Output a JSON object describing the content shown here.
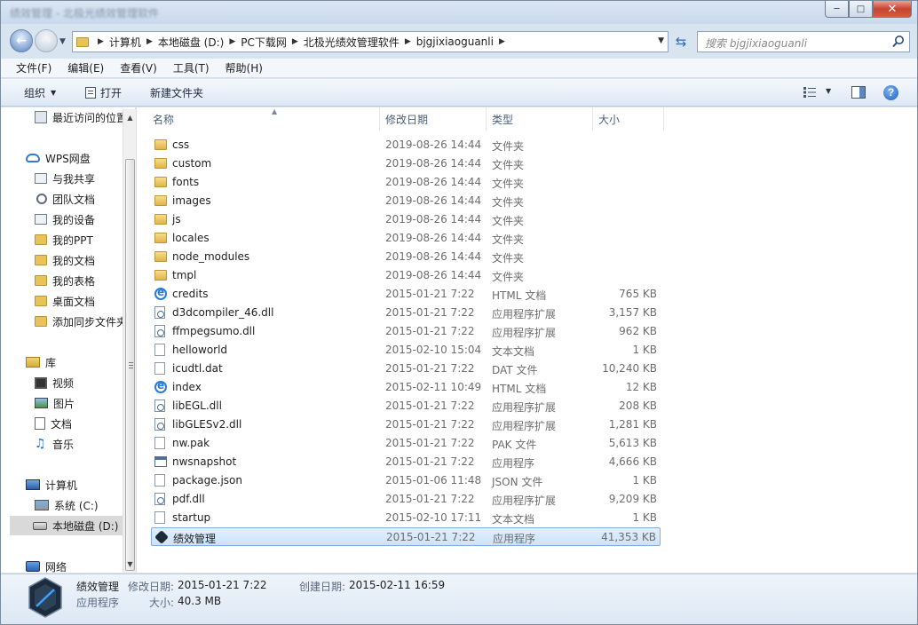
{
  "window": {
    "title": "绩效管理 - 北极光绩效管理软件",
    "minimize": "─",
    "maximize": "□",
    "close": "✕"
  },
  "address": {
    "crumbs": [
      "计算机",
      "本地磁盘 (D:)",
      "PC下载网",
      "北极光绩效管理软件",
      "bjgjixiaoguanli"
    ],
    "search_placeholder": "搜索 bjgjixiaoguanli"
  },
  "menu": [
    "文件(F)",
    "编辑(E)",
    "查看(V)",
    "工具(T)",
    "帮助(H)"
  ],
  "commands": {
    "organize": "组织",
    "open": "打开",
    "new_folder": "新建文件夹"
  },
  "nav": [
    {
      "label": "最近访问的位置",
      "icon": "recent-places-icon"
    },
    {
      "label": "WPS网盘",
      "icon": "cloud-icon"
    },
    {
      "label": "与我共享",
      "icon": "share-icon"
    },
    {
      "label": "团队文档",
      "icon": "team-icon"
    },
    {
      "label": "我的设备",
      "icon": "device-icon"
    },
    {
      "label": "我的PPT",
      "icon": "folder-icon"
    },
    {
      "label": "我的文档",
      "icon": "folder-icon"
    },
    {
      "label": "我的表格",
      "icon": "folder-icon"
    },
    {
      "label": "桌面文档",
      "icon": "folder-icon"
    },
    {
      "label": "添加同步文件夹",
      "icon": "folder-icon"
    },
    {
      "label": "库",
      "icon": "library-icon"
    },
    {
      "label": "视频",
      "icon": "video-icon"
    },
    {
      "label": "图片",
      "icon": "picture-icon"
    },
    {
      "label": "文档",
      "icon": "document-icon"
    },
    {
      "label": "音乐",
      "icon": "music-icon"
    },
    {
      "label": "计算机",
      "icon": "computer-icon"
    },
    {
      "label": "系统 (C:)",
      "icon": "system-drive-icon"
    },
    {
      "label": "本地磁盘 (D:)",
      "icon": "drive-icon"
    },
    {
      "label": "网络",
      "icon": "network-icon"
    }
  ],
  "columns": {
    "name": "名称",
    "date": "修改日期",
    "type": "类型",
    "size": "大小"
  },
  "files": [
    {
      "name": "css",
      "date": "2019-08-26 14:44",
      "type": "文件夹",
      "size": "",
      "icon": "folder"
    },
    {
      "name": "custom",
      "date": "2019-08-26 14:44",
      "type": "文件夹",
      "size": "",
      "icon": "folder"
    },
    {
      "name": "fonts",
      "date": "2019-08-26 14:44",
      "type": "文件夹",
      "size": "",
      "icon": "folder"
    },
    {
      "name": "images",
      "date": "2019-08-26 14:44",
      "type": "文件夹",
      "size": "",
      "icon": "folder"
    },
    {
      "name": "js",
      "date": "2019-08-26 14:44",
      "type": "文件夹",
      "size": "",
      "icon": "folder"
    },
    {
      "name": "locales",
      "date": "2019-08-26 14:44",
      "type": "文件夹",
      "size": "",
      "icon": "folder"
    },
    {
      "name": "node_modules",
      "date": "2019-08-26 14:44",
      "type": "文件夹",
      "size": "",
      "icon": "folder"
    },
    {
      "name": "tmpl",
      "date": "2019-08-26 14:44",
      "type": "文件夹",
      "size": "",
      "icon": "folder"
    },
    {
      "name": "credits",
      "date": "2015-01-21 7:22",
      "type": "HTML 文档",
      "size": "765 KB",
      "icon": "ie"
    },
    {
      "name": "d3dcompiler_46.dll",
      "date": "2015-01-21 7:22",
      "type": "应用程序扩展",
      "size": "3,157 KB",
      "icon": "dll"
    },
    {
      "name": "ffmpegsumo.dll",
      "date": "2015-01-21 7:22",
      "type": "应用程序扩展",
      "size": "962 KB",
      "icon": "dll"
    },
    {
      "name": "helloworld",
      "date": "2015-02-10 15:04",
      "type": "文本文档",
      "size": "1 KB",
      "icon": "text"
    },
    {
      "name": "icudtl.dat",
      "date": "2015-01-21 7:22",
      "type": "DAT 文件",
      "size": "10,240 KB",
      "icon": "text"
    },
    {
      "name": "index",
      "date": "2015-02-11 10:49",
      "type": "HTML 文档",
      "size": "12 KB",
      "icon": "ie"
    },
    {
      "name": "libEGL.dll",
      "date": "2015-01-21 7:22",
      "type": "应用程序扩展",
      "size": "208 KB",
      "icon": "dll"
    },
    {
      "name": "libGLESv2.dll",
      "date": "2015-01-21 7:22",
      "type": "应用程序扩展",
      "size": "1,281 KB",
      "icon": "dll"
    },
    {
      "name": "nw.pak",
      "date": "2015-01-21 7:22",
      "type": "PAK 文件",
      "size": "5,613 KB",
      "icon": "text"
    },
    {
      "name": "nwsnapshot",
      "date": "2015-01-21 7:22",
      "type": "应用程序",
      "size": "4,666 KB",
      "icon": "exe"
    },
    {
      "name": "package.json",
      "date": "2015-01-06 11:48",
      "type": "JSON 文件",
      "size": "1 KB",
      "icon": "text"
    },
    {
      "name": "pdf.dll",
      "date": "2015-01-21 7:22",
      "type": "应用程序扩展",
      "size": "9,209 KB",
      "icon": "dll"
    },
    {
      "name": "startup",
      "date": "2015-02-10 17:11",
      "type": "文本文档",
      "size": "1 KB",
      "icon": "text"
    },
    {
      "name": "绩效管理",
      "date": "2015-01-21 7:22",
      "type": "应用程序",
      "size": "41,353 KB",
      "icon": "app",
      "selected": true
    }
  ],
  "details": {
    "name": "绩效管理",
    "type": "应用程序",
    "modified_label": "修改日期:",
    "modified_value": "2015-01-21 7:22",
    "created_label": "创建日期:",
    "created_value": "2015-02-11 16:59",
    "size_label": "大小:",
    "size_value": "40.3 MB"
  },
  "colors": {
    "accent": "#2d6cc0",
    "selection": "#cce3fb",
    "folder": "#e8c25b"
  }
}
